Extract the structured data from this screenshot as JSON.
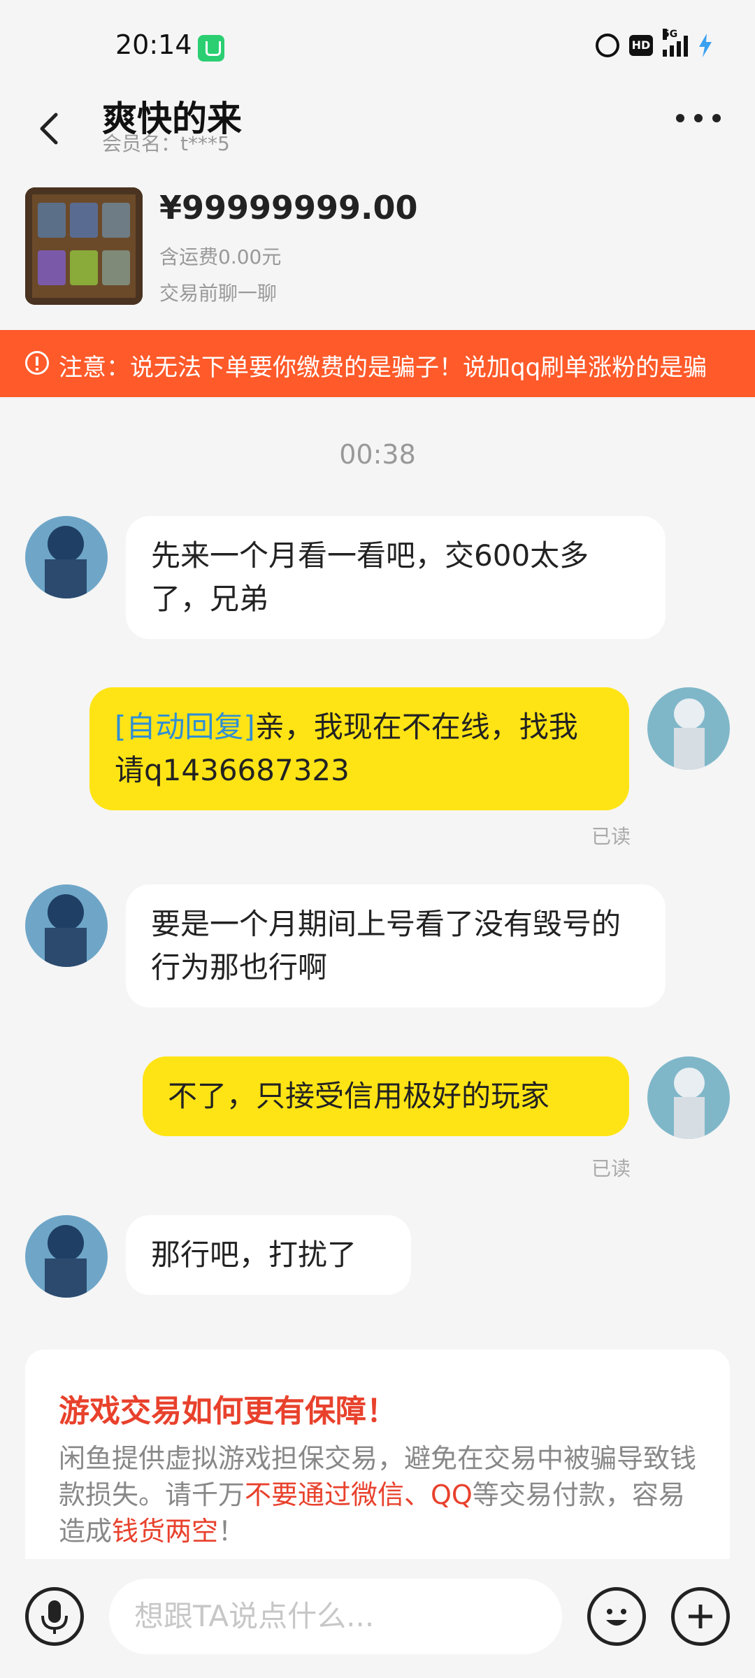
{
  "status_bar": {
    "time": "20:14",
    "hd": "HD",
    "network": "5G"
  },
  "header": {
    "title": "爽快的来",
    "member": "会员名：t***5"
  },
  "product": {
    "price": "¥99999999.00",
    "shipping": "含运费0.00元",
    "chat_before": "交易前聊一聊"
  },
  "warning": {
    "text": "注意：说无法下单要你缴费的是骗子！说加qq刷单涨粉的是骗"
  },
  "chat": {
    "timestamp": "00:38",
    "messages": [
      {
        "side": "left",
        "text": "先来一个月看一看吧，交600太多了，兄弟"
      },
      {
        "side": "right",
        "auto_tag": "[自动回复]",
        "text": "亲，我现在不在线，找我请q1436687323",
        "read": "已读"
      },
      {
        "side": "left",
        "text": "要是一个月期间上号看了没有毁号的行为那也行啊"
      },
      {
        "side": "right",
        "text": "不了，只接受信用极好的玩家",
        "read": "已读"
      },
      {
        "side": "left",
        "text": "那行吧，打扰了"
      }
    ]
  },
  "notice": {
    "title": "游戏交易如何更有保障！",
    "body_1": "闲鱼提供虚拟游戏担保交易，避免在交易中被骗导致钱款损失。请千万",
    "body_red_1": "不要通过微信、QQ",
    "body_2": "等交易付款，容易造成",
    "body_red_2": "钱货两空",
    "body_3": "！"
  },
  "input": {
    "placeholder": "想跟TA说点什么..."
  },
  "colors": {
    "accent_yellow": "#ffe415",
    "warning_orange": "#ff5a2a",
    "link_blue": "#2f8fd3",
    "alert_red": "#e8412c"
  }
}
